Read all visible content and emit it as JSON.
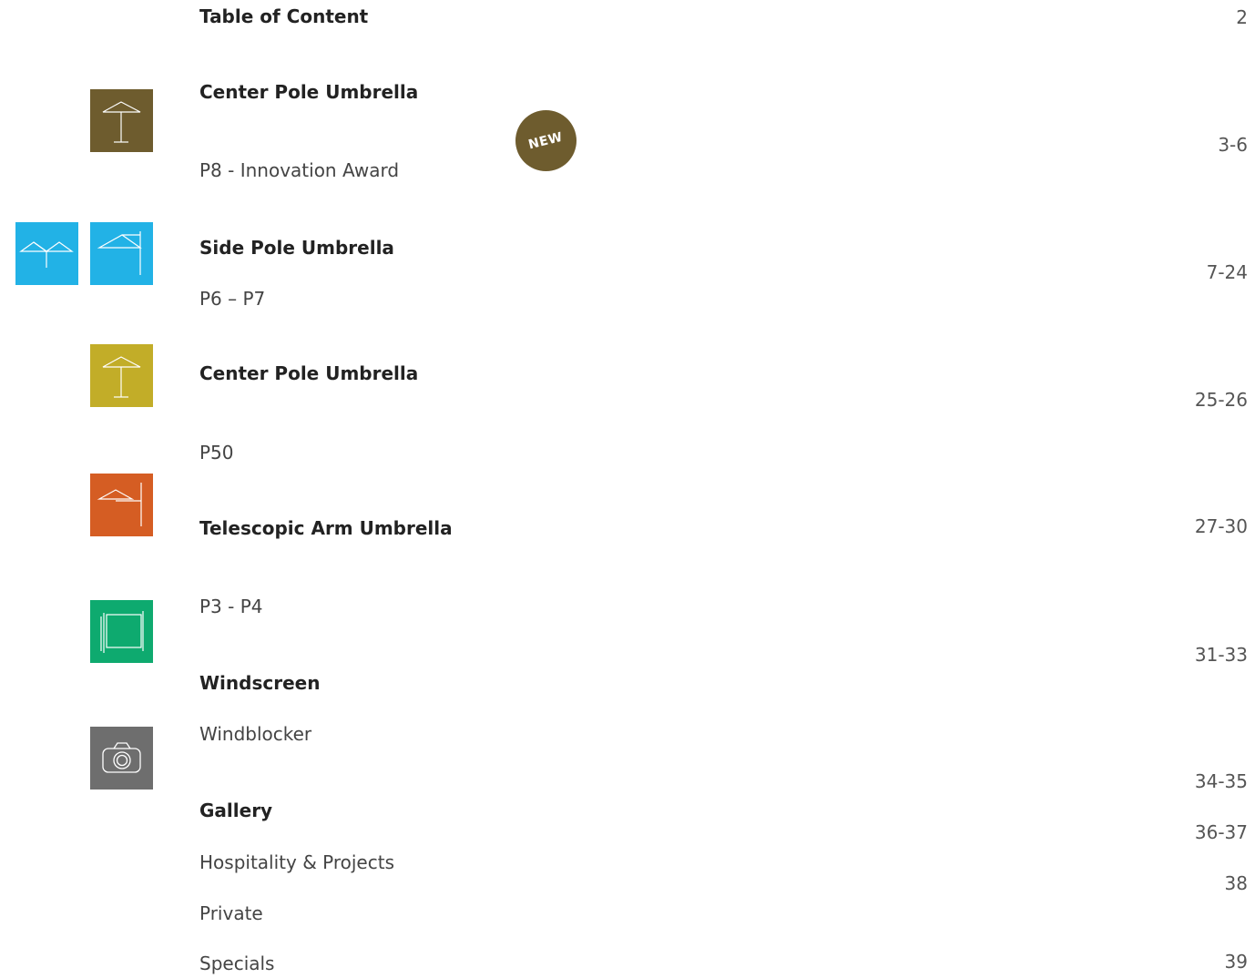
{
  "toc": {
    "title": "Table of Content",
    "title_page": "2"
  },
  "badge": {
    "label": "NEW",
    "color": "#6e5c2e"
  },
  "colors": {
    "olive_brown": "#6e5c2e",
    "sky_blue": "#22b2e6",
    "mustard": "#c2ad28",
    "orange": "#d55d23",
    "green": "#0eaa6f",
    "gray": "#6e6e6e"
  },
  "icons": {
    "center_pole_1": "center-pole-umbrella-icon",
    "side_pole_double": "double-umbrella-icon",
    "side_pole": "side-pole-umbrella-icon",
    "center_pole_2": "center-pole-umbrella-icon",
    "telescopic": "telescopic-arm-umbrella-icon",
    "windscreen": "windscreen-icon",
    "gallery": "camera-icon"
  },
  "entries": {
    "center_pole_1": {
      "heading": "Center Pole Umbrella",
      "sub": "P8 - Innovation Award",
      "pages": "3-6"
    },
    "side_pole": {
      "heading": "Side Pole Umbrella",
      "sub": "P6 – P7",
      "pages": "7-24"
    },
    "center_pole_2": {
      "heading": "Center Pole Umbrella",
      "sub": "P50",
      "pages": "25-26"
    },
    "telescopic": {
      "heading": "Telescopic Arm Umbrella",
      "sub": "P3 -  P4",
      "pages": "27-30"
    },
    "windscreen": {
      "heading": "Windscreen",
      "sub": "Windblocker",
      "pages": "31-33"
    },
    "gallery": {
      "heading": "Gallery",
      "items": [
        {
          "label": "Hospitality & Projects",
          "pages": "34-35"
        },
        {
          "label": "Private",
          "pages": "36-37"
        },
        {
          "label": "Specials",
          "pages": "38"
        }
      ],
      "last_page": "39"
    }
  }
}
